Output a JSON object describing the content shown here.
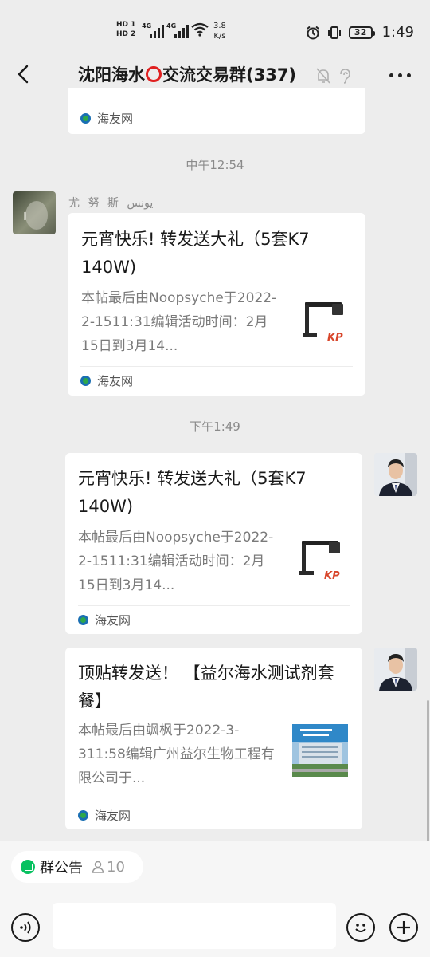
{
  "status_bar": {
    "hd1": "HD 1",
    "hd2": "HD 2",
    "net1": "4G",
    "net2": "4G",
    "speed_value": "3.8",
    "speed_unit": "K/s",
    "battery": "32",
    "time": "1:49"
  },
  "header": {
    "title_left": "沈阳海水",
    "title_right": "交流交易群(337)"
  },
  "messages": [
    {
      "source": "海友网"
    },
    {
      "timestamp": "中午12:54",
      "sender": "尤 努 斯  يونس",
      "title": "元宵快乐! 转发送大礼（5套K7 140W)",
      "desc": "本帖最后由Noopsyche于2022-2-1511:31编辑活动时间：2月15日到3月14...",
      "source": "海友网"
    },
    {
      "timestamp": "下午1:49",
      "title": "元宵快乐! 转发送大礼（5套K7 140W)",
      "desc": "本帖最后由Noopsyche于2022-2-1511:31编辑活动时间：2月15日到3月14...",
      "source": "海友网"
    },
    {
      "title": "顶贴转发送！ 【益尔海水测试剂套餐】",
      "desc": "本帖最后由飒枫于2022-3-311:58编辑广州益尔生物工程有限公司于...",
      "source": "海友网"
    }
  ],
  "thumbs": {
    "kp_label": "KP"
  },
  "bottom": {
    "notice_label": "群公告",
    "notice_count": "10"
  },
  "colors": {
    "background": "#ededed",
    "accent_green": "#07c160",
    "title_ring": "#e02020"
  }
}
